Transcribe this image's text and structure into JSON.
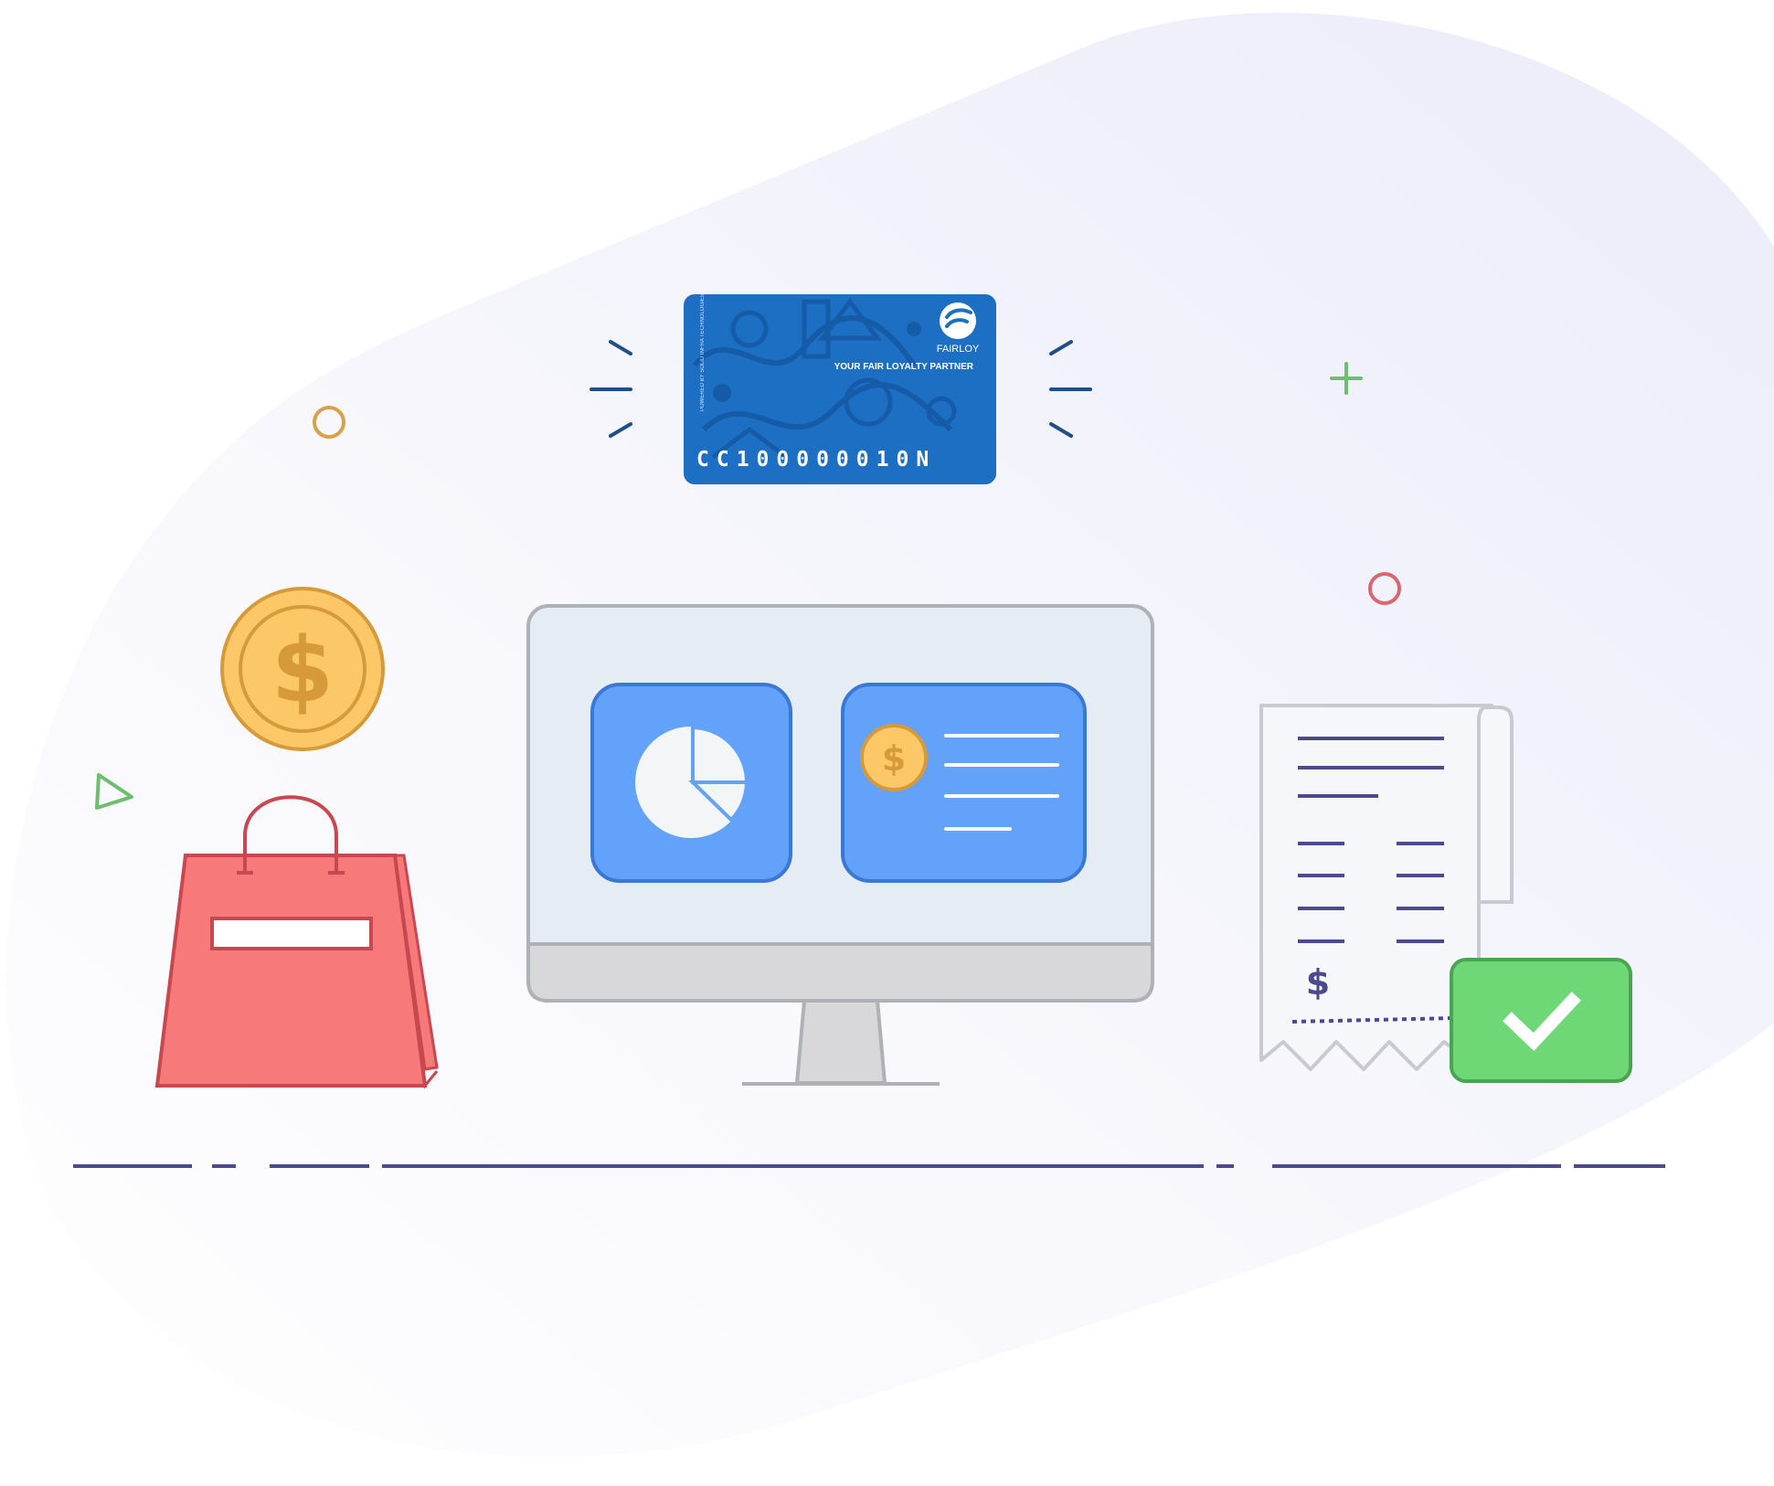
{
  "illustration": {
    "colors": {
      "blob": "#f2f2fb",
      "card_blue": "#1d6fc4",
      "card_dark": "#14579e",
      "accent_navy": "#1f4e8a",
      "panel_blue": "#62a2fb",
      "panel_border": "#3a78d8",
      "coin_fill": "#fcc867",
      "coin_stroke": "#d69a3a",
      "bag_fill": "#f77979",
      "bag_stroke": "#c9474e",
      "check_green": "#6ed776",
      "receipt_line": "#4b4a8c",
      "ground_line": "#4b4a8c",
      "monitor_frame": "#aeb1b7",
      "monitor_screen": "#e5ecf3"
    },
    "loyalty_card": {
      "brand": "FAIRLOY",
      "tagline": "YOUR FAIR LOYALTY PARTNER",
      "side_text": "POWERED BY SOLID INFRA TECHNOLOGIES",
      "number": "CC100000010N"
    },
    "coin_symbol": "$",
    "receipt_symbol": "$",
    "icons": [
      "loyalty-card-icon",
      "dollar-coin-icon",
      "shopping-bag-icon",
      "monitor-icon",
      "pie-chart-icon",
      "receipt-icon",
      "checkmark-icon",
      "circle-decoration-icon",
      "plus-decoration-icon",
      "triangle-decoration-icon"
    ]
  }
}
